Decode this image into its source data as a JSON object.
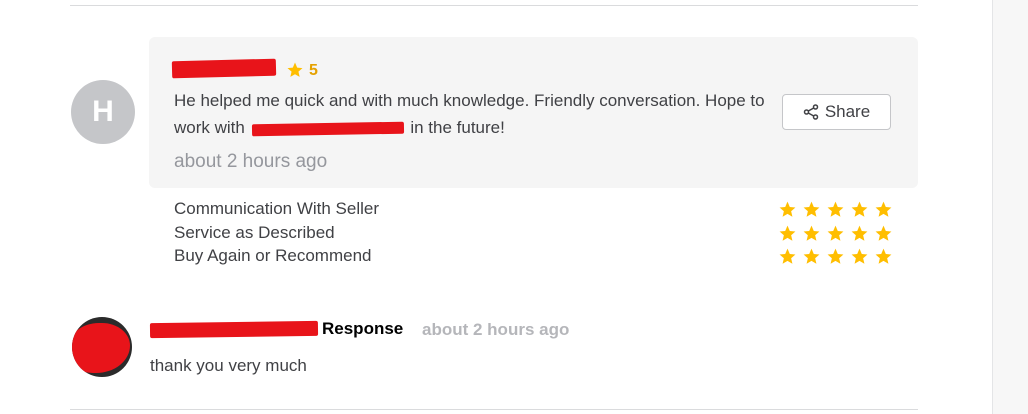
{
  "review": {
    "avatar_letter": "H",
    "rating": "5",
    "text_before": "He helped me quick and with much knowledge. Friendly conversation. Hope to work with",
    "text_after": "in the future!",
    "time": "about 2 hours ago",
    "share_label": "Share"
  },
  "sub_ratings": [
    {
      "label": "Communication With Seller",
      "stars": 5
    },
    {
      "label": "Service as Described",
      "stars": 5
    },
    {
      "label": "Buy Again or Recommend",
      "stars": 5
    }
  ],
  "response": {
    "label": "Response",
    "time": "about 2 hours ago",
    "text": "thank you very much"
  },
  "colors": {
    "star": "#ffbe00",
    "redaction": "#e8141a",
    "card_bg": "#f5f5f5"
  },
  "icons": {
    "rating": "star-icon",
    "share": "share-icon"
  }
}
